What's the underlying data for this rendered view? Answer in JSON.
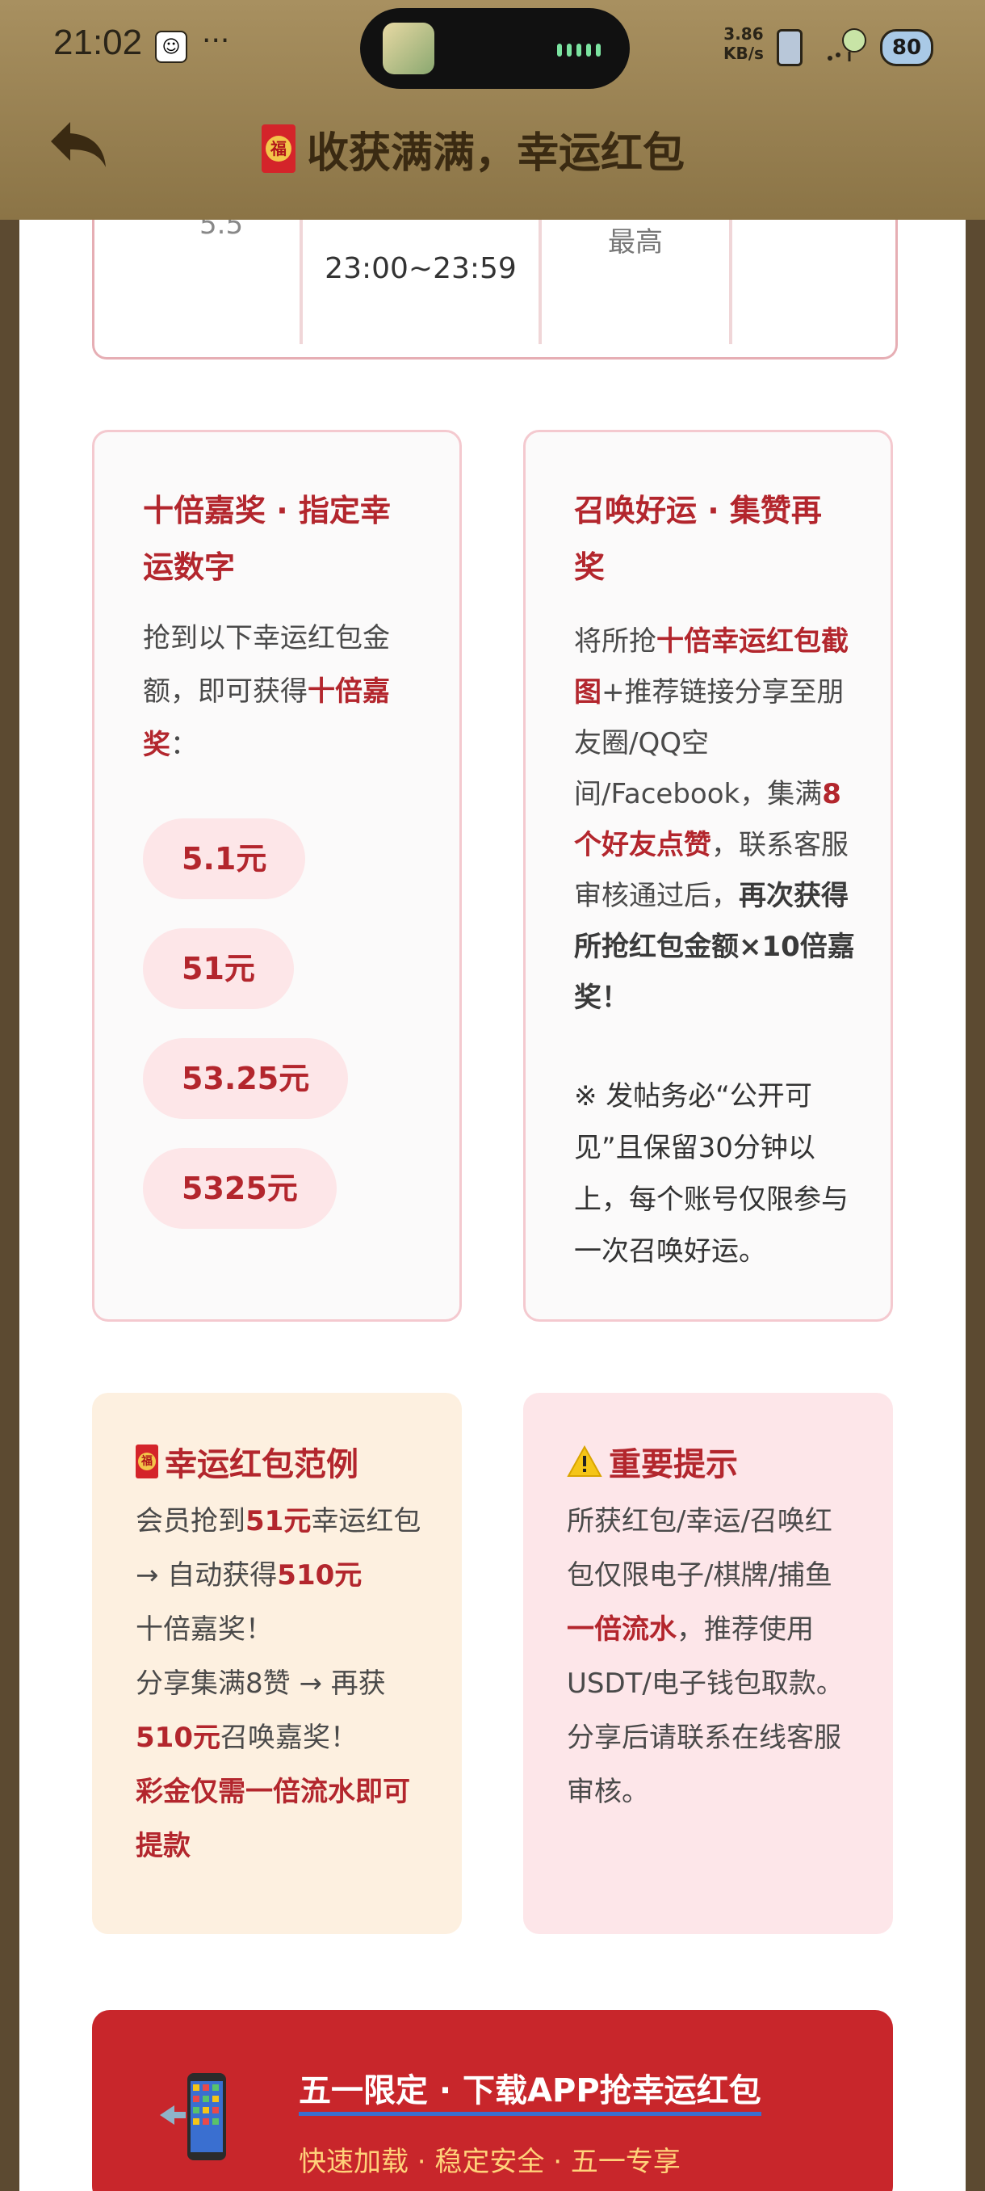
{
  "status_bar": {
    "time": "21:02",
    "dots": "···",
    "net_speed": "3.86",
    "net_unit": "KB/s",
    "battery": "80"
  },
  "header": {
    "title": "收获满满，幸运红包"
  },
  "schedule_row": {
    "cut_text": "5.5",
    "time": "23:00~23:59",
    "max_label": "最高"
  },
  "card_left": {
    "title": "十倍嘉奖 · 指定幸运数字",
    "desc_pre": "抢到以下幸运红包金额，即可获得",
    "desc_red": "十倍嘉奖",
    "desc_post": "：",
    "amounts": [
      "5.1元",
      "51元",
      "53.25元",
      "5325元"
    ]
  },
  "card_right": {
    "title": "召唤好运 · 集赞再奖",
    "p1": "将所抢",
    "p2_red": "十倍幸运红包截图",
    "p3": "+推荐链接分享至朋友圈/QQ空间/Facebook，集满",
    "p4_red": "8个好友点赞",
    "p5": "，联系客服审核通过后，",
    "p6_strong": "再次获得所抢红包金额×10倍嘉奖！",
    "note": "※ 发帖务必“公开可见”且保留30分钟以上，每个账号仅限参与一次召唤好运。"
  },
  "example_box": {
    "title": "幸运红包范例",
    "t1": "会员抢到",
    "t2_red": "51元",
    "t3": "幸运红包 → 自动获得",
    "t4_red": "510元",
    "t5": "十倍嘉奖！",
    "t6": "分享集满8赞 → 再获",
    "t7_red": "510元",
    "t8": "召唤嘉奖！",
    "t9_red": "彩金仅需一倍流水即可提款"
  },
  "notice_box": {
    "title": "重要提示",
    "t1": "所获红包/幸运/召唤红包仅限电子/棋牌/捕鱼",
    "t2_red": "一倍流水",
    "t3": "，推荐使用USDT/电子钱包取款。分享后请联系在线客服审核。"
  },
  "banner": {
    "title": "五一限定 · 下载APP抢幸运红包",
    "subtitle": "快速加载 · 稳定安全 · 五一专享"
  }
}
